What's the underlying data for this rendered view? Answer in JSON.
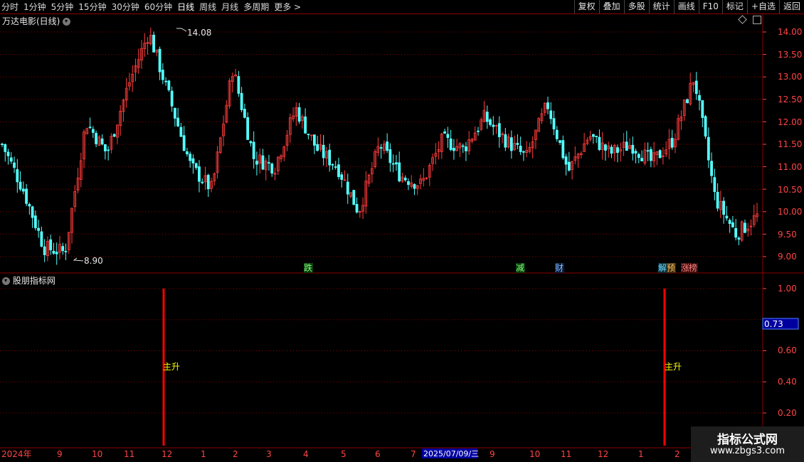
{
  "toolbar": {
    "periods": [
      "分时",
      "1分钟",
      "5分钟",
      "15分钟",
      "30分钟",
      "60分钟",
      "日线",
      "周线",
      "月线",
      "多周期",
      "更多 >"
    ],
    "active": "日线",
    "buttons": [
      "复权",
      "叠加",
      "多股",
      "统计",
      "画线",
      "F10",
      "标记",
      "+自选",
      "返回"
    ]
  },
  "price_panel": {
    "title": "万达电影(日线)",
    "y_ticks": [
      "14.00",
      "13.50",
      "13.00",
      "12.50",
      "12.00",
      "11.50",
      "11.00",
      "10.50",
      "10.00",
      "9.50",
      "9.00"
    ],
    "high_label": "14.08",
    "low_label": "8.90",
    "event_tags": [
      "跌",
      "减",
      "财",
      "解",
      "预",
      "涨",
      "榜"
    ]
  },
  "indicator_panel": {
    "title": "股朋指标网",
    "y_ticks": [
      "1.00",
      "0.60",
      "0.40",
      "0.20"
    ],
    "current_value": "0.73",
    "signal_label": "主升"
  },
  "time_axis": {
    "labels": [
      "2024年",
      "9",
      "10",
      "11",
      "12",
      "1",
      "2",
      "3",
      "4",
      "5",
      "6",
      "7",
      "9",
      "10",
      "11",
      "12",
      "1",
      "2"
    ],
    "cursor_date": "2025/07/09/三"
  },
  "watermark": {
    "line1": "指标公式网",
    "line2": "www.zbgs3.com"
  },
  "colors": {
    "up": "#ff3c3c",
    "down": "#54ffff",
    "grid": "#8b0000",
    "signal": "#ff0000",
    "label_yellow": "#ffff00"
  },
  "chart_data": [
    {
      "type": "candlestick",
      "title": "万达电影(日线)",
      "ylim": [
        8.7,
        14.3
      ],
      "annotations": {
        "high": 14.08,
        "low": 8.9
      },
      "x": [
        "2024-08",
        "2024-09",
        "2024-10",
        "2024-11",
        "2024-12",
        "2025-01",
        "2025-02",
        "2025-03",
        "2025-04",
        "2025-05",
        "2025-06",
        "2025-07",
        "2025-09",
        "2025-10",
        "2025-11",
        "2025-12",
        "2026-01",
        "2026-02"
      ],
      "close_path": [
        11.5,
        10.5,
        9.2,
        9.1,
        12.0,
        11.3,
        12.8,
        14.0,
        12.5,
        11.0,
        10.5,
        13.2,
        11.2,
        11.0,
        12.3,
        11.4,
        11.0,
        10.0,
        11.5,
        10.8,
        10.6,
        11.6,
        11.4,
        12.1,
        11.6,
        11.2,
        12.4,
        10.9,
        11.7,
        11.3,
        11.5,
        11.1,
        11.6,
        13.0,
        10.3,
        9.5,
        9.9
      ]
    },
    {
      "type": "bar",
      "title": "股朋指标网",
      "ylim": [
        0,
        1.05
      ],
      "signals": [
        {
          "label": "主升",
          "value": 1.0
        },
        {
          "label": "主升",
          "value": 1.0
        }
      ],
      "current_value": 0.73
    }
  ]
}
